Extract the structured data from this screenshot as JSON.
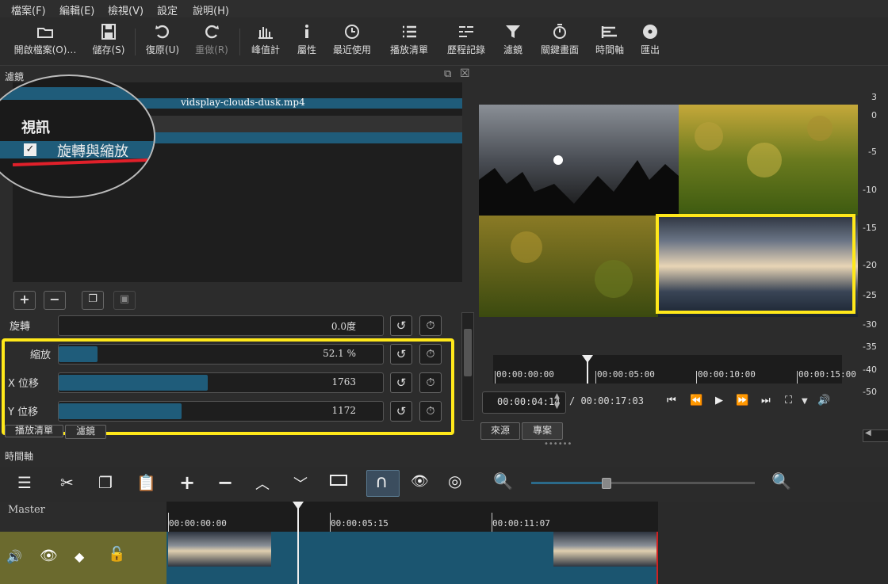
{
  "menu": [
    "檔案(F)",
    "編輯(E)",
    "檢視(V)",
    "設定",
    "說明(H)"
  ],
  "toolbar": {
    "open": "開啟檔案(O)…",
    "save": "儲存(S)",
    "undo": "復原(U)",
    "redo": "重做(R)",
    "peak_meter": "峰值計",
    "properties": "屬性",
    "recent": "最近使用",
    "playlist": "播放清單",
    "history": "歷程記錄",
    "filters": "濾鏡",
    "keyframes": "關鍵畫面",
    "timeline": "時間軸",
    "export": "匯出"
  },
  "filters_panel": {
    "title": "濾鏡",
    "clip_name": "vidsplay-clouds-dusk.mp4",
    "section": "視訊",
    "filter_item": "旋轉與縮放",
    "rotation": {
      "label": "旋轉",
      "value": "0.0度",
      "fraction": 0.0
    },
    "scale": {
      "label": "縮放",
      "value": "52.1 %",
      "fraction": 0.12
    },
    "x_offset": {
      "label": "X 位移",
      "value": "1763",
      "fraction": 0.46
    },
    "y_offset": {
      "label": "Y 位移",
      "value": "1172",
      "fraction": 0.38
    },
    "tab_playlist": "播放清單",
    "tab_filters": "濾鏡"
  },
  "player": {
    "current_time": "00:00:04:14",
    "total_time": "/ 00:00:17:03",
    "ruler": [
      "00:00:00:00",
      "00:00:05:00",
      "00:00:10:00",
      "00:00:15:00"
    ],
    "tab_source": "來源",
    "tab_project": "專案"
  },
  "audio_meter": [
    "3",
    "0",
    "-5",
    "-10",
    "-15",
    "-20",
    "-25",
    "-30",
    "-35",
    "-40",
    "-50"
  ],
  "timeline": {
    "title": "時間軸",
    "master": "Master",
    "ruler": [
      "00:00:00:00",
      "00:00:05:15",
      "00:00:11:07"
    ]
  },
  "colors": {
    "accent": "#1f5c7a",
    "highlight": "#ffe81a",
    "track": "#6b6a2e",
    "clip": "#1b5570"
  }
}
